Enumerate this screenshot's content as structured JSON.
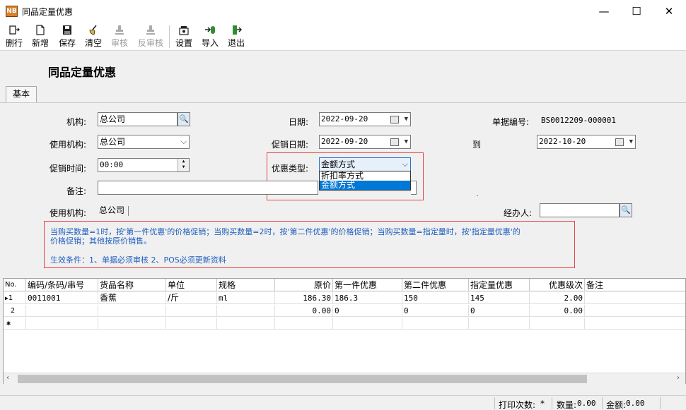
{
  "window": {
    "icon_text": "NB",
    "title": "同品定量优惠",
    "minimize_glyph": "—",
    "maximize_glyph": "☐",
    "close_glyph": "✕"
  },
  "toolbar": {
    "delete_row": "删行",
    "new": "新增",
    "save": "保存",
    "clear": "清空",
    "approve": "审核",
    "unapprove": "反审核",
    "settings": "设置",
    "import": "导入",
    "exit": "退出"
  },
  "page_title": "同品定量优惠",
  "tabs": {
    "basic": "基本"
  },
  "form": {
    "org_label": "机构:",
    "org_value": "总公司",
    "date_label": "日期:",
    "date_value": "2022-09-20",
    "doc_no_label": "单据编号:",
    "doc_no_value": "BS0012209-000001",
    "use_org_label": "使用机构:",
    "use_org_value": "总公司",
    "promo_date_label": "促销日期:",
    "promo_date_from": "2022-09-20",
    "to_label": "到",
    "promo_date_to": "2022-10-20",
    "promo_time_label": "促销时间:",
    "promo_time_value": "00:00",
    "discount_type_label": "优惠类型:",
    "discount_type_value": "金额方式",
    "discount_type_options": [
      "折扣率方式",
      "金额方式"
    ],
    "remark_label": "备注:",
    "remark_value": "",
    "use_org2_label": "使用机构:",
    "use_org2_value": "总公司",
    "handler_label": "经办人:",
    "handler_value": ""
  },
  "note": {
    "line1": "当购买数量=1时，按'第一件优惠'的价格促销；当购买数量=2时，按'第二件优惠'的价格促销；当购买数量=指定量时，按'指定量优惠'的",
    "line2": "价格促销；其他按原价销售。",
    "line3": "生效条件：1、单据必须审核 2、POS必须更新资料"
  },
  "grid": {
    "headers": {
      "no": "No.",
      "code": "编码/条码/串号",
      "name": "货品名称",
      "unit": "单位",
      "spec": "规格",
      "orig_price": "原价",
      "first": "第一件优惠",
      "second": "第二件优惠",
      "qty_discount": "指定量优惠",
      "level": "优惠级次",
      "remark": "备注"
    },
    "rows": [
      {
        "no": "1",
        "code": "0011001",
        "name": "香蕉",
        "unit": "/斤",
        "spec": "ml",
        "orig_price": "186.30",
        "first": "186.3",
        "second": "150",
        "qty_discount": "145",
        "level": "2.00",
        "remark": ""
      },
      {
        "no": "2",
        "code": "",
        "name": "",
        "unit": "",
        "spec": "",
        "orig_price": "0.00",
        "first": "0",
        "second": "0",
        "qty_discount": "0",
        "level": "0.00",
        "remark": ""
      }
    ],
    "current_marker": "▶",
    "new_row_marker": "✱"
  },
  "status": {
    "print_count_label": "打印次数:",
    "print_count_value": "*",
    "qty_label": "数量:",
    "qty_value": "0.00",
    "amount_label": "金额:",
    "amount_value": "0.00"
  }
}
